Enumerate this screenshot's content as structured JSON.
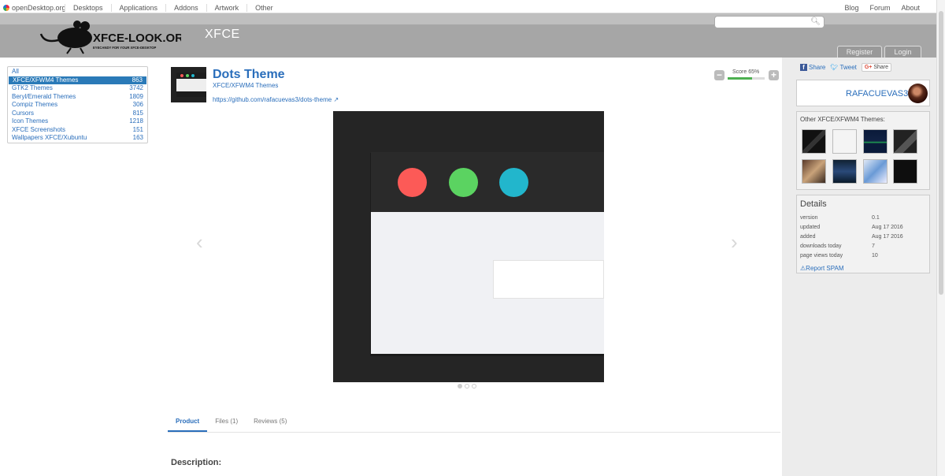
{
  "topnav": {
    "site": "openDesktop.org",
    "items": [
      "Desktops",
      "Applications",
      "Addons",
      "Artwork",
      "Other"
    ],
    "right": [
      "Blog",
      "Forum",
      "About"
    ]
  },
  "header": {
    "logo_text": "XFCE-LOOK.ORG",
    "logo_tagline": "EYECANDY FOR YOUR XFCE-DESKTOP",
    "section_title": "XFCE",
    "search_placeholder": "",
    "register_label": "Register",
    "login_label": "Login"
  },
  "categories": [
    {
      "name": "All",
      "count": ""
    },
    {
      "name": "XFCE/XFWM4 Themes",
      "count": "863"
    },
    {
      "name": "GTK2 Themes",
      "count": "3742"
    },
    {
      "name": "Beryl/Emerald Themes",
      "count": "1809"
    },
    {
      "name": "Compiz Themes",
      "count": "306"
    },
    {
      "name": "Cursors",
      "count": "815"
    },
    {
      "name": "Icon Themes",
      "count": "1218"
    },
    {
      "name": "XFCE Screenshots",
      "count": "151"
    },
    {
      "name": "Wallpapers XFCE/Xubuntu",
      "count": "163"
    }
  ],
  "product": {
    "title": "Dots Theme",
    "category": "XFCE/XFWM4 Themes",
    "link": "https://github.com/rafacuevas3/dots-theme",
    "score_label": "Score 65%",
    "score": 0.65
  },
  "slide_colors": {
    "red": "#fc5a57",
    "green": "#5bd361",
    "blue": "#22b6cc"
  },
  "tabs": [
    "Product",
    "Files (1)",
    "Reviews (5)"
  ],
  "description_label": "Description:",
  "share": {
    "facebook": "Share",
    "twitter": "Tweet",
    "gplus": "Share"
  },
  "user": {
    "name": "RAFACUEVAS3"
  },
  "other_themes_label": "Other XFCE/XFWM4 Themes:",
  "details": {
    "heading": "Details",
    "rows": [
      {
        "label": "version",
        "value": "0.1"
      },
      {
        "label": "updated",
        "value": "Aug 17 2016"
      },
      {
        "label": "added",
        "value": "Aug 17 2016"
      },
      {
        "label": "downloads today",
        "value": "7"
      },
      {
        "label": "page views today",
        "value": "10"
      }
    ],
    "report": "Report SPAM"
  }
}
